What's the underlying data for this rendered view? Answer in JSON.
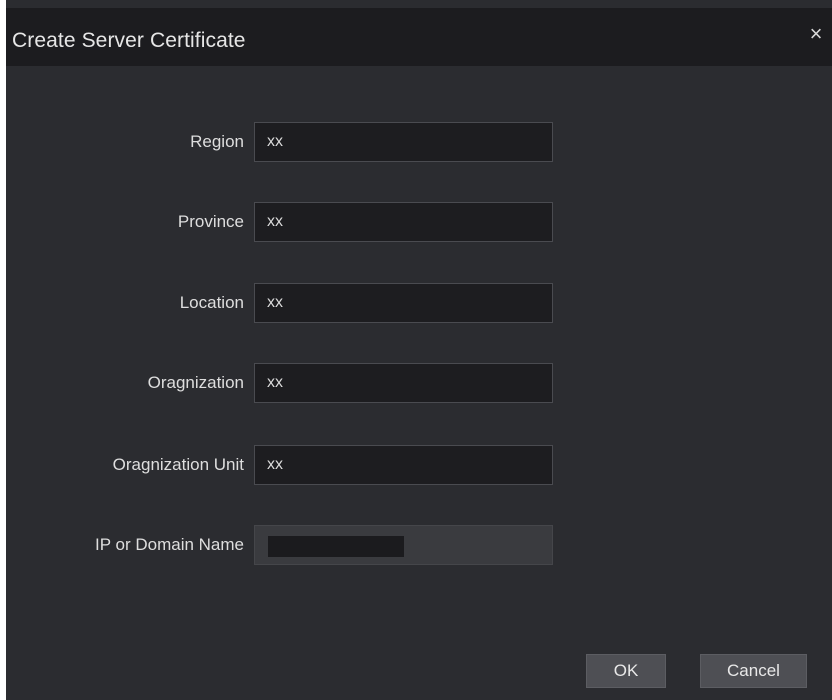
{
  "dialog": {
    "title": "Create Server Certificate",
    "close_glyph": "×",
    "close_icon": "close-icon"
  },
  "form": {
    "fields": [
      {
        "label": "Region",
        "value": "xx"
      },
      {
        "label": "Province",
        "value": "xx"
      },
      {
        "label": "Location",
        "value": "xx"
      },
      {
        "label": "Oragnization",
        "value": "xx"
      },
      {
        "label": "Oragnization Unit",
        "value": "xx"
      },
      {
        "label": "IP or Domain Name",
        "value": ""
      }
    ]
  },
  "buttons": {
    "ok": "OK",
    "cancel": "Cancel"
  },
  "colors": {
    "dialog_bg": "#2b2c30",
    "titlebar_bg": "#1c1c1f",
    "input_bg": "#1d1d20",
    "button_bg": "#4e4f54"
  }
}
